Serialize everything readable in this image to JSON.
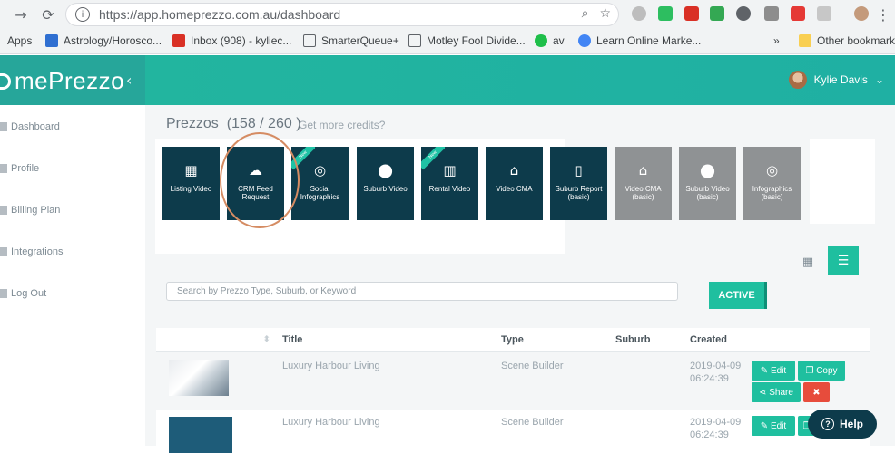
{
  "browser": {
    "url": "https://app.homeprezzo.com.au/dashboard",
    "bookmarks": [
      "Apps",
      "Astrology/Horosco...",
      "Inbox (908) - kyliec...",
      "SmarterQueue+",
      "Motley Fool Divide...",
      "av",
      "Learn Online Marke...",
      "»",
      "Other bookmarks"
    ]
  },
  "app": {
    "logo_text": "mePrezzo",
    "user_name": "Kylie Davis",
    "sidebar": [
      "Dashboard",
      "Profile",
      "Billing Plan",
      "Integrations",
      "Log Out"
    ]
  },
  "main": {
    "title_prefix": "Prezzos",
    "title_count": "(158 / 260 )",
    "credits_link": "Get more credits?",
    "tiles": [
      {
        "label": "Listing Video",
        "icon": "film-icon",
        "variant": "dark",
        "ribbon": ""
      },
      {
        "label": "CRM Feed Request",
        "icon": "upload-cloud-icon",
        "variant": "dark",
        "ribbon": ""
      },
      {
        "label": "Social Infographics",
        "icon": "instagram-icon",
        "variant": "dark",
        "ribbon": "New"
      },
      {
        "label": "Suburb Video",
        "icon": "location-pin-icon",
        "variant": "dark",
        "ribbon": ""
      },
      {
        "label": "Rental Video",
        "icon": "building-icon",
        "variant": "dark",
        "ribbon": "New"
      },
      {
        "label": "Video CMA",
        "icon": "house-icon",
        "variant": "dark",
        "ribbon": ""
      },
      {
        "label": "Suburb Report (basic)",
        "icon": "pdf-icon",
        "variant": "dark",
        "ribbon": ""
      },
      {
        "label": "Video CMA (basic)",
        "icon": "house-icon",
        "variant": "basic",
        "ribbon": ""
      },
      {
        "label": "Suburb Video (basic)",
        "icon": "location-pin-icon",
        "variant": "basic",
        "ribbon": ""
      },
      {
        "label": "Infographics (basic)",
        "icon": "instagram-icon",
        "variant": "basic",
        "ribbon": ""
      }
    ],
    "search_placeholder": "Search by Prezzo Type, Suburb, or Keyword",
    "filter_label": "ACTIVE",
    "table": {
      "headers": [
        "Title",
        "Type",
        "Suburb",
        "Created"
      ],
      "rows": [
        {
          "title": "Luxury Harbour Living",
          "type": "Scene Builder",
          "suburb": "",
          "date": "2019-04-09",
          "time": "06:24:39"
        },
        {
          "title": "Luxury Harbour Living",
          "type": "Scene Builder",
          "suburb": "",
          "date": "2019-04-09",
          "time": "06:24:39"
        }
      ],
      "actions": {
        "edit": "Edit",
        "copy": "Copy",
        "share": "Share"
      }
    },
    "help_label": "Help"
  },
  "colors": {
    "teal": "#1fbf9f",
    "navy": "#0d3b4b",
    "red": "#e74c3c"
  }
}
